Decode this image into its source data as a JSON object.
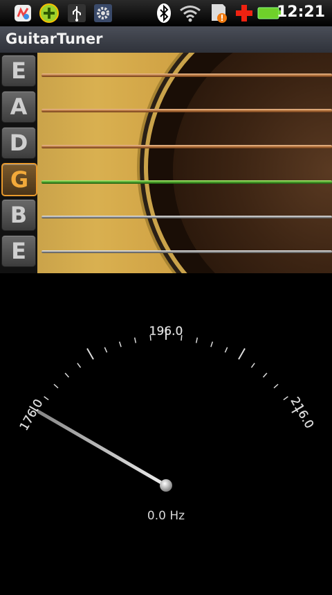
{
  "status_bar": {
    "time": "12:21",
    "icons": [
      "app-icon",
      "add-icon",
      "usb-icon",
      "settings-icon",
      "bluetooth-icon",
      "wifi-icon",
      "sd-card-alert-icon",
      "red-cross-icon",
      "battery-icon"
    ]
  },
  "app": {
    "title": "GuitarTuner"
  },
  "strings": [
    {
      "note": "E",
      "selected": false,
      "kind": "copper"
    },
    {
      "note": "A",
      "selected": false,
      "kind": "copper"
    },
    {
      "note": "D",
      "selected": false,
      "kind": "copper"
    },
    {
      "note": "G",
      "selected": true,
      "kind": "active"
    },
    {
      "note": "B",
      "selected": false,
      "kind": "silver"
    },
    {
      "note": "E",
      "selected": false,
      "kind": "silver"
    }
  ],
  "gauge": {
    "min_label": "176.0",
    "center_label": "196.0",
    "max_label": "216.0",
    "min": 176.0,
    "center": 196.0,
    "max": 216.0,
    "reading": 176.0
  },
  "readout": {
    "frequency": "0.0 Hz"
  },
  "colors": {
    "selected_string": "#e99a2c",
    "active_string": "#4aa22a"
  }
}
